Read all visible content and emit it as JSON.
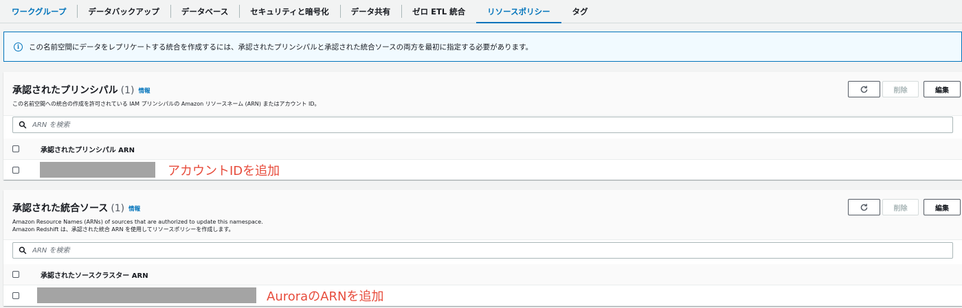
{
  "tabs": [
    {
      "label": "ワークグループ",
      "style": "link"
    },
    {
      "label": "データバックアップ",
      "style": "normal"
    },
    {
      "label": "データベース",
      "style": "normal"
    },
    {
      "label": "セキュリティと暗号化",
      "style": "normal"
    },
    {
      "label": "データ共有",
      "style": "normal"
    },
    {
      "label": "ゼロ ETL 統合",
      "style": "normal"
    },
    {
      "label": "リソースポリシー",
      "style": "active"
    },
    {
      "label": "タグ",
      "style": "normal"
    }
  ],
  "alert": {
    "icon": "info-icon",
    "text": "この名前空間にデータをレプリケートする統合を作成するには、承認されたプリンシパルと承認された統合ソースの両方を最初に指定する必要があります。"
  },
  "principals_panel": {
    "title": "承認されたプリンシパル",
    "count": "(1)",
    "info": "情報",
    "description": "この名前空間への統合の作成を許可されている IAM プリンシパルの Amazon リソースネーム (ARN) またはアカウント ID。",
    "delete_label": "削除",
    "edit_label": "編集",
    "search_placeholder": "ARN を検索",
    "column_header": "承認されたプリンシパル ARN",
    "annotation": "アカウントIDを追加"
  },
  "sources_panel": {
    "title": "承認された統合ソース",
    "count": "(1)",
    "info": "情報",
    "description_line1": "Amazon Resource Names (ARNs) of sources that are authorized to update this namespace.",
    "description_line2": "Amazon Redshift は、承認された統合 ARN を使用してリソースポリシーを作成します。",
    "delete_label": "削除",
    "edit_label": "編集",
    "search_placeholder": "ARN を検索",
    "column_header": "承認されたソースクラスター ARN",
    "annotation": "AuroraのARNを追加"
  },
  "colors": {
    "accent": "#0073bb",
    "annotation": "#e74c3c",
    "redacted": "#a4a4a4"
  }
}
